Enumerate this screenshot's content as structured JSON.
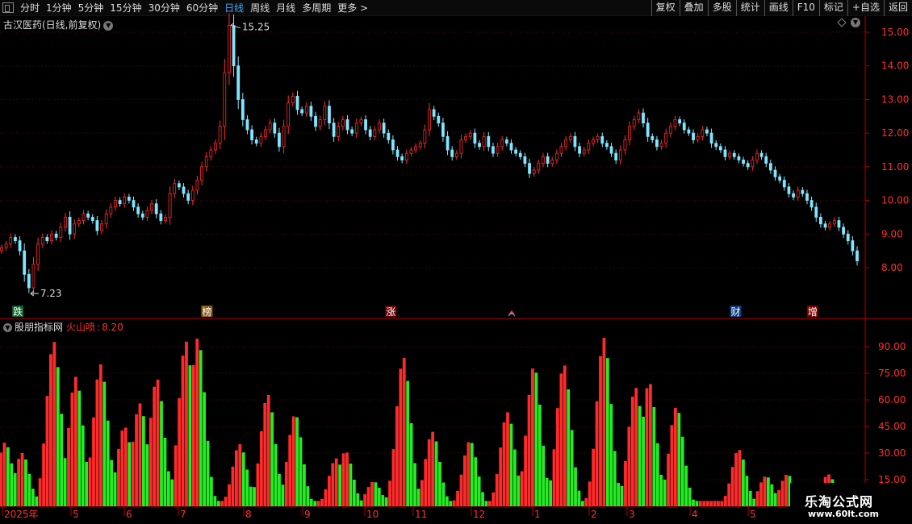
{
  "toolbar": {
    "periods": [
      {
        "label": "分时",
        "active": false
      },
      {
        "label": "1分钟",
        "active": false
      },
      {
        "label": "5分钟",
        "active": false
      },
      {
        "label": "15分钟",
        "active": false
      },
      {
        "label": "30分钟",
        "active": false
      },
      {
        "label": "60分钟",
        "active": false
      },
      {
        "label": "日线",
        "active": true
      },
      {
        "label": "周线",
        "active": false
      },
      {
        "label": "月线",
        "active": false
      },
      {
        "label": "多周期",
        "active": false
      },
      {
        "label": "更多 >",
        "active": false
      }
    ],
    "buttons": [
      "复权",
      "叠加",
      "多股",
      "统计",
      "画线",
      "F10",
      "标记",
      "+自选",
      "返回"
    ]
  },
  "main_panel": {
    "title": "古汉医药(日线,前复权)",
    "high_label": "15.25",
    "low_label": "7.23",
    "markers": [
      "跌",
      "榜",
      "涨",
      "财",
      "增"
    ]
  },
  "indicator_panel": {
    "name": "股朋指标网",
    "line_name": "火山喷",
    "line_value": "8.20"
  },
  "x_axis_labels": [
    "2025年",
    "5",
    "6",
    "7",
    "8",
    "9",
    "10",
    "11",
    "12",
    "1",
    "2",
    "3",
    "4",
    "5"
  ],
  "watermark": {
    "line1": "乐淘公式网",
    "line2": "www.60lt.com"
  },
  "colors": {
    "up": "#ff2a2a",
    "down": "#22ee22",
    "axis": "#b40000",
    "grid": "#5a0000",
    "text_red": "#ff3030",
    "active_tab": "#3fa9ff"
  },
  "chart_data": [
    {
      "type": "candlestick",
      "title": "古汉医药(日线,前复权)",
      "y_ticks": [
        8.0,
        9.0,
        10.0,
        11.0,
        12.0,
        13.0,
        14.0,
        15.0
      ],
      "ylim": [
        7.0,
        15.6
      ],
      "high": 15.25,
      "low": 7.23,
      "closes": [
        8.6,
        8.7,
        8.9,
        8.8,
        8.5,
        7.8,
        7.4,
        8.1,
        8.7,
        8.9,
        8.8,
        9.0,
        8.9,
        9.2,
        9.5,
        9.0,
        9.3,
        9.4,
        9.6,
        9.5,
        9.4,
        9.1,
        9.3,
        9.6,
        9.8,
        10.0,
        9.9,
        10.1,
        10.0,
        9.8,
        9.6,
        9.5,
        9.7,
        9.9,
        9.6,
        9.4,
        9.5,
        10.2,
        10.5,
        10.4,
        10.2,
        10.0,
        10.3,
        10.6,
        11.0,
        11.3,
        11.5,
        11.7,
        12.2,
        13.8,
        15.2,
        14.0,
        13.0,
        12.4,
        12.1,
        11.8,
        11.7,
        11.9,
        12.1,
        12.3,
        12.0,
        11.6,
        12.2,
        12.9,
        13.1,
        12.7,
        12.6,
        12.8,
        12.5,
        12.2,
        12.4,
        12.8,
        12.3,
        11.9,
        12.2,
        12.4,
        12.1,
        12.0,
        12.3,
        12.4,
        12.1,
        11.9,
        12.1,
        12.3,
        12.0,
        11.8,
        11.5,
        11.3,
        11.2,
        11.4,
        11.5,
        11.6,
        11.7,
        12.1,
        12.7,
        12.5,
        12.3,
        11.9,
        11.5,
        11.3,
        11.4,
        11.8,
        11.9,
        12.0,
        11.7,
        11.6,
        11.9,
        11.6,
        11.4,
        11.6,
        11.8,
        11.7,
        11.5,
        11.4,
        11.3,
        11.1,
        10.8,
        10.9,
        11.1,
        11.3,
        11.1,
        11.2,
        11.4,
        11.6,
        11.8,
        11.9,
        11.6,
        11.4,
        11.5,
        11.7,
        11.8,
        11.9,
        11.7,
        11.6,
        11.4,
        11.2,
        11.5,
        11.8,
        12.2,
        12.4,
        12.6,
        12.3,
        11.9,
        11.8,
        11.6,
        11.7,
        12.0,
        12.2,
        12.4,
        12.3,
        12.1,
        12.0,
        11.8,
        11.9,
        12.1,
        12.0,
        11.7,
        11.6,
        11.5,
        11.3,
        11.4,
        11.3,
        11.2,
        11.1,
        11.0,
        11.2,
        11.4,
        11.3,
        11.1,
        10.9,
        10.7,
        10.6,
        10.4,
        10.2,
        10.1,
        10.3,
        10.2,
        10.0,
        9.8,
        9.5,
        9.3,
        9.2,
        9.3,
        9.4,
        9.2,
        9.0,
        8.8,
        8.5,
        8.2
      ]
    },
    {
      "type": "bar",
      "title": "股朋指标网 火山喷",
      "y_ticks": [
        15.0,
        30.0,
        45.0,
        60.0,
        75.0,
        90.0
      ],
      "ylim": [
        0,
        100
      ],
      "last_value": 8.2,
      "peaks": [
        {
          "pos": 0.005,
          "value": 36
        },
        {
          "pos": 0.025,
          "value": 30
        },
        {
          "pos": 0.062,
          "value": 93
        },
        {
          "pos": 0.088,
          "value": 73
        },
        {
          "pos": 0.117,
          "value": 80
        },
        {
          "pos": 0.145,
          "value": 45
        },
        {
          "pos": 0.163,
          "value": 58
        },
        {
          "pos": 0.183,
          "value": 72
        },
        {
          "pos": 0.217,
          "value": 93
        },
        {
          "pos": 0.231,
          "value": 95
        },
        {
          "pos": 0.28,
          "value": 35
        },
        {
          "pos": 0.313,
          "value": 63
        },
        {
          "pos": 0.345,
          "value": 52
        },
        {
          "pos": 0.393,
          "value": 27
        },
        {
          "pos": 0.404,
          "value": 31
        },
        {
          "pos": 0.437,
          "value": 14
        },
        {
          "pos": 0.472,
          "value": 84
        },
        {
          "pos": 0.506,
          "value": 42
        },
        {
          "pos": 0.55,
          "value": 37
        },
        {
          "pos": 0.594,
          "value": 53
        },
        {
          "pos": 0.625,
          "value": 79
        },
        {
          "pos": 0.66,
          "value": 80
        },
        {
          "pos": 0.707,
          "value": 95
        },
        {
          "pos": 0.744,
          "value": 67
        },
        {
          "pos": 0.76,
          "value": 70
        },
        {
          "pos": 0.792,
          "value": 56
        },
        {
          "pos": 0.865,
          "value": 32
        },
        {
          "pos": 0.897,
          "value": 17
        },
        {
          "pos": 0.922,
          "value": 18
        },
        {
          "pos": 0.97,
          "value": 18
        }
      ]
    }
  ]
}
